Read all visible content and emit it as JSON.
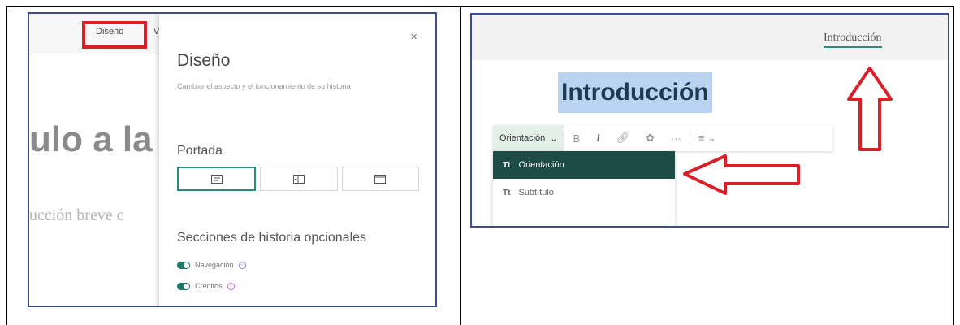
{
  "left": {
    "tabs": {
      "diseno": "Diseño",
      "vi": "Vi"
    },
    "background": {
      "title_fragment": "ulo a la",
      "intro_fragment": "ucción breve c"
    },
    "panel": {
      "close": "×",
      "title": "Diseño",
      "description": "Cambiar el aspecto y el funcionamiento de su historia",
      "portada_label": "Portada",
      "sections_label": "Secciones de historia opcionales",
      "toggles": [
        {
          "label": "Navegación",
          "on": true
        },
        {
          "label": "Créditos",
          "on": true
        }
      ]
    }
  },
  "right": {
    "nav_label": "Introducción",
    "heading": "Introducción",
    "toolbar": {
      "style_label": "Orientación",
      "bold": "B",
      "italic": "I",
      "more": "···"
    },
    "dropdown": [
      {
        "icon": "Tt",
        "label": "Orientación",
        "active": true
      },
      {
        "icon": "Tt",
        "label": "Subtítulo",
        "active": false
      }
    ]
  },
  "colors": {
    "accent": "#2c8c7e",
    "highlight": "#d9202a",
    "selection": "#b9d3f0",
    "active_item": "#1d4b45"
  }
}
